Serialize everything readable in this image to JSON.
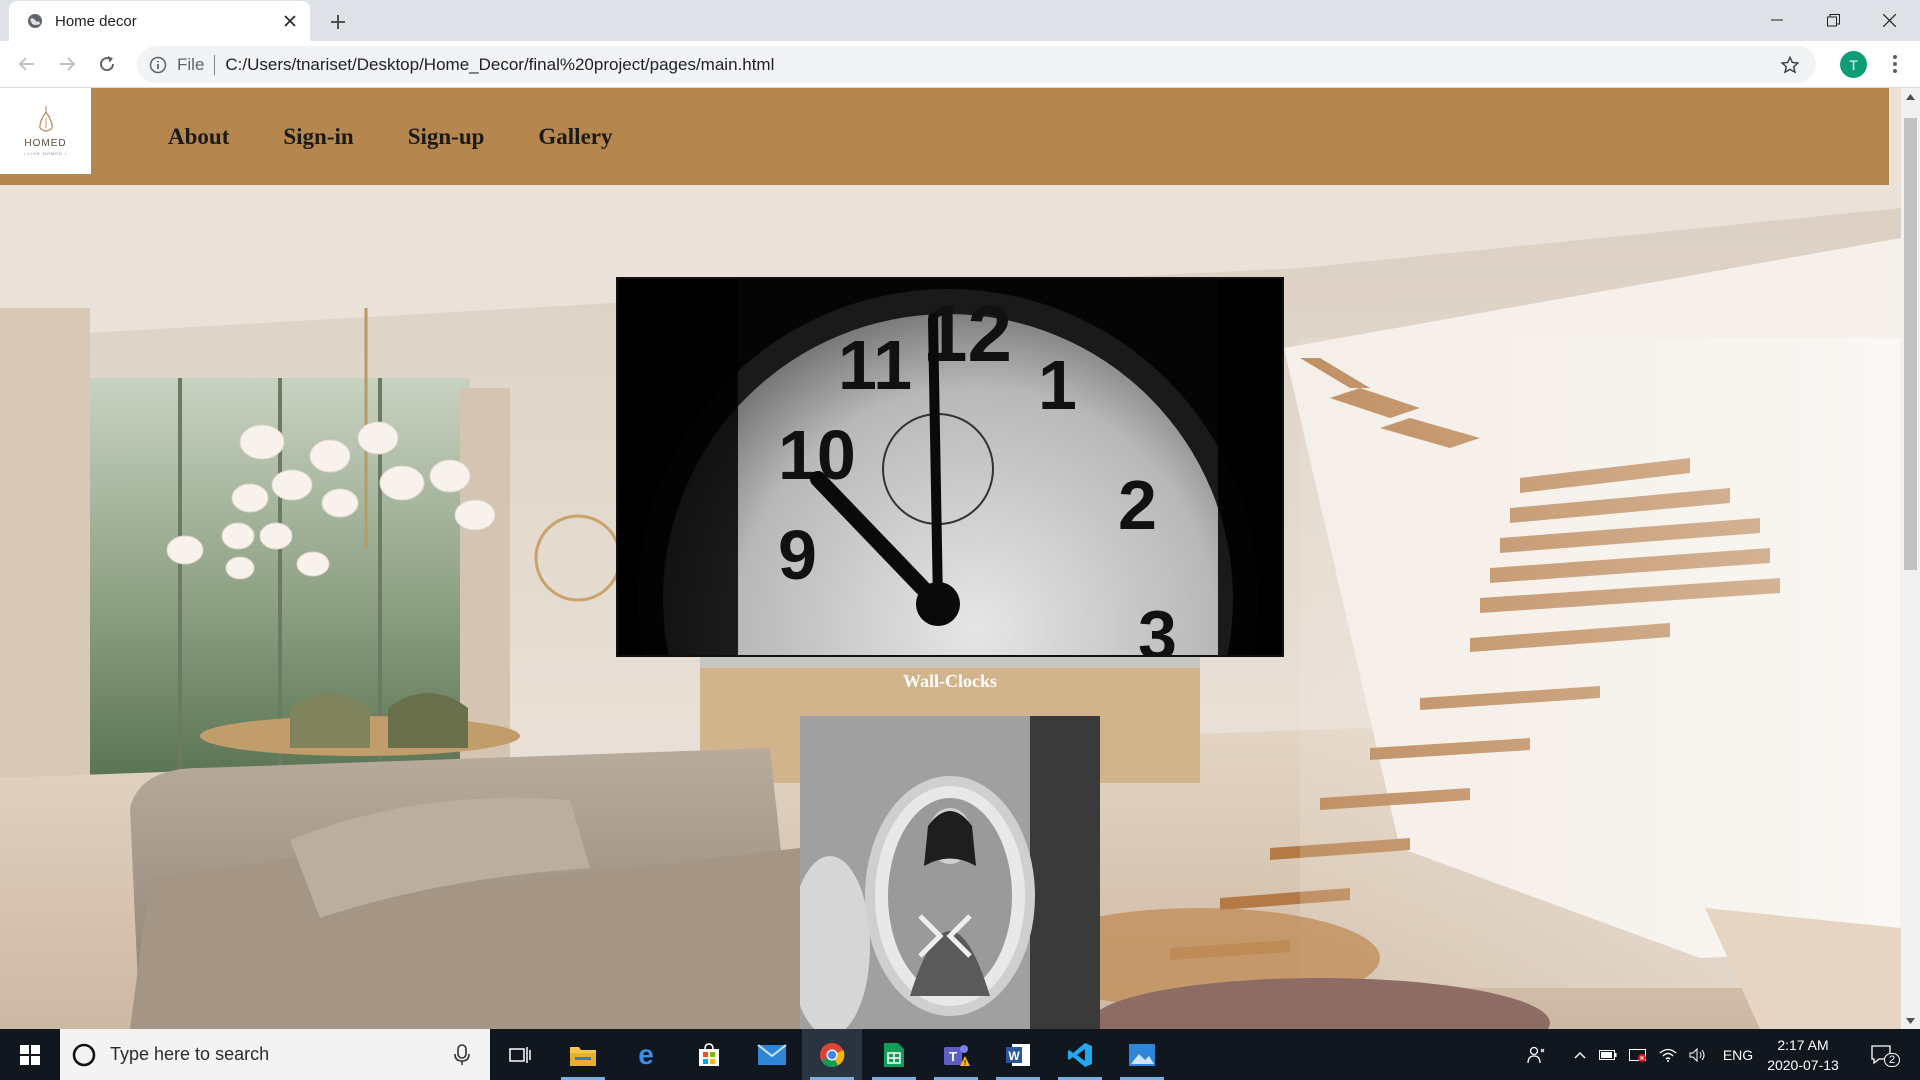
{
  "browser": {
    "tab_title": "Home decor",
    "url_scheme": "File",
    "url": "C:/Users/tnariset/Desktop/Home_Decor/final%20project/pages/main.html",
    "profile_initial": "T"
  },
  "site": {
    "logo_name": "HOMED",
    "logo_tagline": "• LIVE HOMED •",
    "nav": [
      "About",
      "Sign-in",
      "Sign-up",
      "Gallery"
    ],
    "gallery": {
      "caption_1": "Wall-Clocks"
    },
    "colors": {
      "header": "#b5874f"
    }
  },
  "taskbar": {
    "search_placeholder": "Type here to search",
    "language": "ENG",
    "time": "2:17 AM",
    "date": "2020-07-13",
    "notification_count": "2",
    "apps": [
      "file-explorer",
      "edge",
      "store",
      "mail",
      "chrome",
      "sheets",
      "teams",
      "word",
      "vscode",
      "photos"
    ]
  }
}
